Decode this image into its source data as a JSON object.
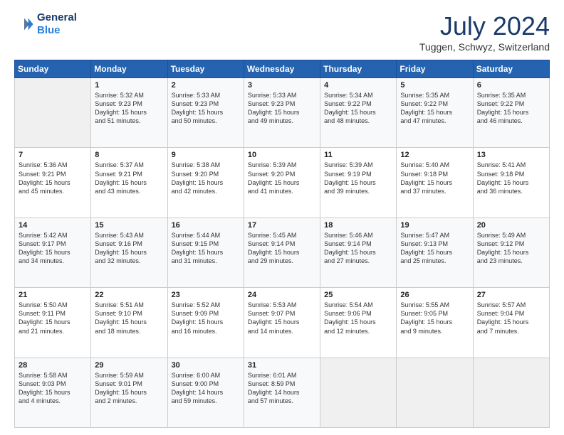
{
  "header": {
    "logo_line1": "General",
    "logo_line2": "Blue",
    "title": "July 2024",
    "subtitle": "Tuggen, Schwyz, Switzerland"
  },
  "calendar": {
    "days_of_week": [
      "Sunday",
      "Monday",
      "Tuesday",
      "Wednesday",
      "Thursday",
      "Friday",
      "Saturday"
    ],
    "weeks": [
      [
        {
          "day": "",
          "content": ""
        },
        {
          "day": "1",
          "content": "Sunrise: 5:32 AM\nSunset: 9:23 PM\nDaylight: 15 hours\nand 51 minutes."
        },
        {
          "day": "2",
          "content": "Sunrise: 5:33 AM\nSunset: 9:23 PM\nDaylight: 15 hours\nand 50 minutes."
        },
        {
          "day": "3",
          "content": "Sunrise: 5:33 AM\nSunset: 9:23 PM\nDaylight: 15 hours\nand 49 minutes."
        },
        {
          "day": "4",
          "content": "Sunrise: 5:34 AM\nSunset: 9:22 PM\nDaylight: 15 hours\nand 48 minutes."
        },
        {
          "day": "5",
          "content": "Sunrise: 5:35 AM\nSunset: 9:22 PM\nDaylight: 15 hours\nand 47 minutes."
        },
        {
          "day": "6",
          "content": "Sunrise: 5:35 AM\nSunset: 9:22 PM\nDaylight: 15 hours\nand 46 minutes."
        }
      ],
      [
        {
          "day": "7",
          "content": "Sunrise: 5:36 AM\nSunset: 9:21 PM\nDaylight: 15 hours\nand 45 minutes."
        },
        {
          "day": "8",
          "content": "Sunrise: 5:37 AM\nSunset: 9:21 PM\nDaylight: 15 hours\nand 43 minutes."
        },
        {
          "day": "9",
          "content": "Sunrise: 5:38 AM\nSunset: 9:20 PM\nDaylight: 15 hours\nand 42 minutes."
        },
        {
          "day": "10",
          "content": "Sunrise: 5:39 AM\nSunset: 9:20 PM\nDaylight: 15 hours\nand 41 minutes."
        },
        {
          "day": "11",
          "content": "Sunrise: 5:39 AM\nSunset: 9:19 PM\nDaylight: 15 hours\nand 39 minutes."
        },
        {
          "day": "12",
          "content": "Sunrise: 5:40 AM\nSunset: 9:18 PM\nDaylight: 15 hours\nand 37 minutes."
        },
        {
          "day": "13",
          "content": "Sunrise: 5:41 AM\nSunset: 9:18 PM\nDaylight: 15 hours\nand 36 minutes."
        }
      ],
      [
        {
          "day": "14",
          "content": "Sunrise: 5:42 AM\nSunset: 9:17 PM\nDaylight: 15 hours\nand 34 minutes."
        },
        {
          "day": "15",
          "content": "Sunrise: 5:43 AM\nSunset: 9:16 PM\nDaylight: 15 hours\nand 32 minutes."
        },
        {
          "day": "16",
          "content": "Sunrise: 5:44 AM\nSunset: 9:15 PM\nDaylight: 15 hours\nand 31 minutes."
        },
        {
          "day": "17",
          "content": "Sunrise: 5:45 AM\nSunset: 9:14 PM\nDaylight: 15 hours\nand 29 minutes."
        },
        {
          "day": "18",
          "content": "Sunrise: 5:46 AM\nSunset: 9:14 PM\nDaylight: 15 hours\nand 27 minutes."
        },
        {
          "day": "19",
          "content": "Sunrise: 5:47 AM\nSunset: 9:13 PM\nDaylight: 15 hours\nand 25 minutes."
        },
        {
          "day": "20",
          "content": "Sunrise: 5:49 AM\nSunset: 9:12 PM\nDaylight: 15 hours\nand 23 minutes."
        }
      ],
      [
        {
          "day": "21",
          "content": "Sunrise: 5:50 AM\nSunset: 9:11 PM\nDaylight: 15 hours\nand 21 minutes."
        },
        {
          "day": "22",
          "content": "Sunrise: 5:51 AM\nSunset: 9:10 PM\nDaylight: 15 hours\nand 18 minutes."
        },
        {
          "day": "23",
          "content": "Sunrise: 5:52 AM\nSunset: 9:09 PM\nDaylight: 15 hours\nand 16 minutes."
        },
        {
          "day": "24",
          "content": "Sunrise: 5:53 AM\nSunset: 9:07 PM\nDaylight: 15 hours\nand 14 minutes."
        },
        {
          "day": "25",
          "content": "Sunrise: 5:54 AM\nSunset: 9:06 PM\nDaylight: 15 hours\nand 12 minutes."
        },
        {
          "day": "26",
          "content": "Sunrise: 5:55 AM\nSunset: 9:05 PM\nDaylight: 15 hours\nand 9 minutes."
        },
        {
          "day": "27",
          "content": "Sunrise: 5:57 AM\nSunset: 9:04 PM\nDaylight: 15 hours\nand 7 minutes."
        }
      ],
      [
        {
          "day": "28",
          "content": "Sunrise: 5:58 AM\nSunset: 9:03 PM\nDaylight: 15 hours\nand 4 minutes."
        },
        {
          "day": "29",
          "content": "Sunrise: 5:59 AM\nSunset: 9:01 PM\nDaylight: 15 hours\nand 2 minutes."
        },
        {
          "day": "30",
          "content": "Sunrise: 6:00 AM\nSunset: 9:00 PM\nDaylight: 14 hours\nand 59 minutes."
        },
        {
          "day": "31",
          "content": "Sunrise: 6:01 AM\nSunset: 8:59 PM\nDaylight: 14 hours\nand 57 minutes."
        },
        {
          "day": "",
          "content": ""
        },
        {
          "day": "",
          "content": ""
        },
        {
          "day": "",
          "content": ""
        }
      ]
    ]
  }
}
